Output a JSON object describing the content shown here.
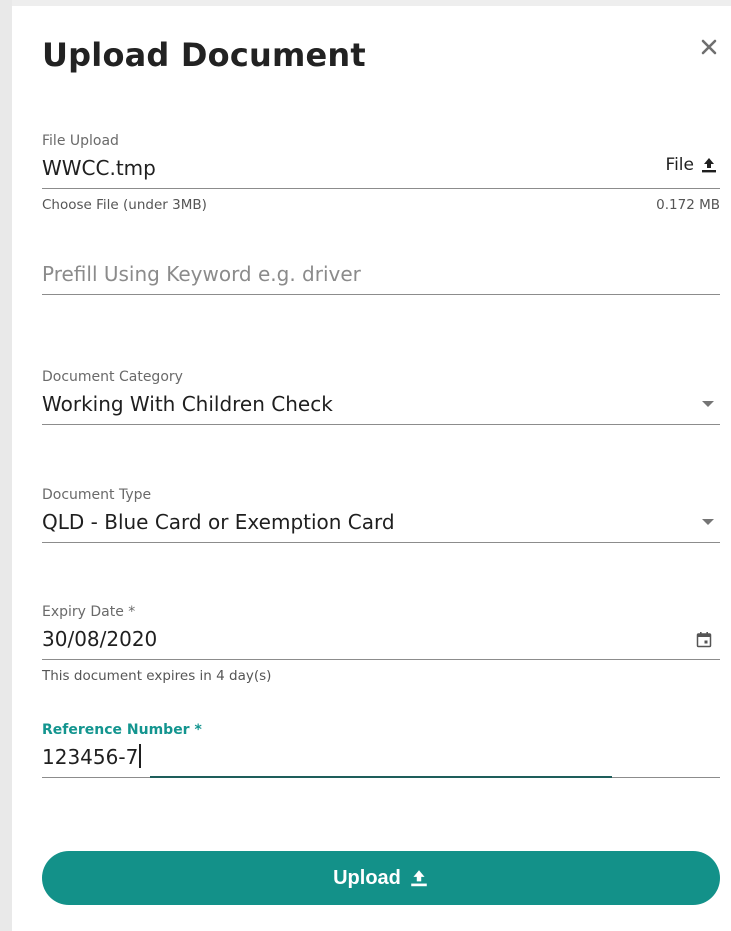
{
  "dialog": {
    "title": "Upload Document",
    "close_icon": "close-icon"
  },
  "file_upload": {
    "label": "File Upload",
    "value": "WWCC.tmp",
    "button_label": "File",
    "button_icon": "upload-icon",
    "hint": "Choose File (under 3MB)",
    "size": "0.172 MB"
  },
  "prefill": {
    "placeholder": "Prefill Using Keyword e.g. driver"
  },
  "document_category": {
    "label": "Document Category",
    "value": "Working With Children Check"
  },
  "document_type": {
    "label": "Document Type",
    "value": "QLD - Blue Card or Exemption Card"
  },
  "expiry_date": {
    "label": "Expiry Date *",
    "value": "30/08/2020",
    "hint": "This document expires in 4 day(s)"
  },
  "reference_number": {
    "label": "Reference Number *",
    "value": "123456-7"
  },
  "upload_button": {
    "label": "Upload",
    "icon": "upload-icon"
  },
  "colors": {
    "accent": "#139189",
    "active_label": "#13958f",
    "focus_underline": "#1e5e5b"
  }
}
